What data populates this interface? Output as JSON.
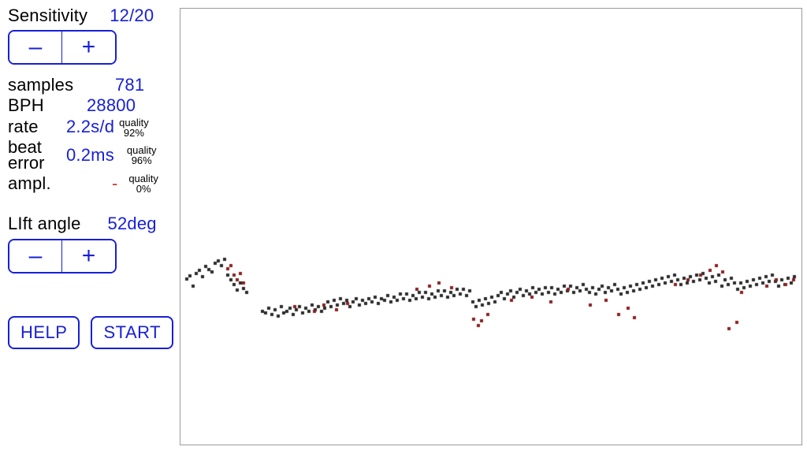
{
  "sensitivity": {
    "label": "Sensitivity",
    "value": "12/20"
  },
  "stepper_minus": "–",
  "stepper_plus": "+",
  "samples": {
    "label": "samples",
    "value": "781"
  },
  "bph": {
    "label": "BPH",
    "value": "28800"
  },
  "rate": {
    "label": "rate",
    "value": "2.2s/d",
    "quality_label": "quality",
    "quality_value": "92%"
  },
  "beat": {
    "label_line1": "beat",
    "label_line2": "error",
    "value": "0.2ms",
    "quality_label": "quality",
    "quality_value": "96%"
  },
  "ampl": {
    "label": "ampl.",
    "value": "-",
    "quality_label": "quality",
    "quality_value": "0%"
  },
  "lift": {
    "label": "LIft angle",
    "value": "52deg"
  },
  "buttons": {
    "help": "HELP",
    "start": "START"
  },
  "colors": {
    "accent": "#1720d6",
    "dot_black": "#2b2b2b",
    "dot_red": "#8a2020"
  },
  "chart_data": {
    "type": "scatter",
    "title": "",
    "xlabel": "",
    "ylabel": "",
    "xlim": [
      0,
      788
    ],
    "ylim": [
      0,
      553
    ],
    "series": [
      {
        "name": "black",
        "points": [
          [
            8,
            343
          ],
          [
            12,
            339
          ],
          [
            16,
            352
          ],
          [
            20,
            336
          ],
          [
            24,
            332
          ],
          [
            28,
            340
          ],
          [
            32,
            327
          ],
          [
            36,
            331
          ],
          [
            40,
            334
          ],
          [
            44,
            323
          ],
          [
            48,
            320
          ],
          [
            52,
            326
          ],
          [
            56,
            318
          ],
          [
            60,
            338
          ],
          [
            64,
            344
          ],
          [
            68,
            350
          ],
          [
            72,
            357
          ],
          [
            76,
            348
          ],
          [
            80,
            355
          ],
          [
            84,
            360
          ],
          [
            104,
            384
          ],
          [
            108,
            386
          ],
          [
            112,
            380
          ],
          [
            116,
            388
          ],
          [
            120,
            382
          ],
          [
            124,
            390
          ],
          [
            128,
            378
          ],
          [
            131,
            386
          ],
          [
            135,
            384
          ],
          [
            139,
            380
          ],
          [
            143,
            388
          ],
          [
            147,
            382
          ],
          [
            151,
            378
          ],
          [
            155,
            386
          ],
          [
            159,
            380
          ],
          [
            163,
            384
          ],
          [
            167,
            376
          ],
          [
            171,
            382
          ],
          [
            175,
            378
          ],
          [
            179,
            384
          ],
          [
            183,
            380
          ],
          [
            187,
            372
          ],
          [
            191,
            378
          ],
          [
            195,
            370
          ],
          [
            199,
            376
          ],
          [
            203,
            368
          ],
          [
            207,
            374
          ],
          [
            211,
            370
          ],
          [
            215,
            378
          ],
          [
            219,
            372
          ],
          [
            223,
            368
          ],
          [
            227,
            376
          ],
          [
            231,
            370
          ],
          [
            235,
            374
          ],
          [
            239,
            368
          ],
          [
            243,
            372
          ],
          [
            247,
            366
          ],
          [
            251,
            374
          ],
          [
            255,
            368
          ],
          [
            259,
            370
          ],
          [
            263,
            364
          ],
          [
            267,
            372
          ],
          [
            271,
            366
          ],
          [
            275,
            370
          ],
          [
            279,
            362
          ],
          [
            283,
            368
          ],
          [
            287,
            362
          ],
          [
            291,
            370
          ],
          [
            295,
            364
          ],
          [
            299,
            368
          ],
          [
            303,
            360
          ],
          [
            307,
            366
          ],
          [
            311,
            360
          ],
          [
            315,
            368
          ],
          [
            319,
            362
          ],
          [
            323,
            366
          ],
          [
            327,
            358
          ],
          [
            331,
            364
          ],
          [
            335,
            358
          ],
          [
            339,
            366
          ],
          [
            343,
            360
          ],
          [
            347,
            364
          ],
          [
            351,
            356
          ],
          [
            355,
            362
          ],
          [
            359,
            356
          ],
          [
            363,
            364
          ],
          [
            367,
            358
          ],
          [
            371,
            372
          ],
          [
            375,
            378
          ],
          [
            379,
            370
          ],
          [
            383,
            376
          ],
          [
            387,
            368
          ],
          [
            391,
            374
          ],
          [
            395,
            366
          ],
          [
            399,
            372
          ],
          [
            403,
            364
          ],
          [
            407,
            360
          ],
          [
            411,
            368
          ],
          [
            415,
            362
          ],
          [
            419,
            358
          ],
          [
            423,
            366
          ],
          [
            427,
            360
          ],
          [
            431,
            356
          ],
          [
            435,
            364
          ],
          [
            439,
            358
          ],
          [
            443,
            362
          ],
          [
            447,
            354
          ],
          [
            451,
            360
          ],
          [
            455,
            356
          ],
          [
            459,
            362
          ],
          [
            463,
            354
          ],
          [
            467,
            360
          ],
          [
            471,
            354
          ],
          [
            475,
            362
          ],
          [
            479,
            356
          ],
          [
            483,
            360
          ],
          [
            487,
            352
          ],
          [
            491,
            358
          ],
          [
            495,
            352
          ],
          [
            499,
            360
          ],
          [
            503,
            354
          ],
          [
            507,
            358
          ],
          [
            511,
            350
          ],
          [
            515,
            356
          ],
          [
            519,
            360
          ],
          [
            523,
            354
          ],
          [
            527,
            362
          ],
          [
            531,
            356
          ],
          [
            535,
            352
          ],
          [
            539,
            360
          ],
          [
            543,
            354
          ],
          [
            547,
            358
          ],
          [
            551,
            350
          ],
          [
            555,
            356
          ],
          [
            559,
            362
          ],
          [
            563,
            354
          ],
          [
            567,
            360
          ],
          [
            571,
            352
          ],
          [
            575,
            358
          ],
          [
            579,
            350
          ],
          [
            583,
            356
          ],
          [
            587,
            348
          ],
          [
            591,
            354
          ],
          [
            595,
            346
          ],
          [
            599,
            352
          ],
          [
            603,
            344
          ],
          [
            607,
            350
          ],
          [
            611,
            342
          ],
          [
            615,
            348
          ],
          [
            619,
            340
          ],
          [
            623,
            346
          ],
          [
            627,
            338
          ],
          [
            631,
            344
          ],
          [
            635,
            350
          ],
          [
            639,
            342
          ],
          [
            643,
            348
          ],
          [
            647,
            340
          ],
          [
            651,
            346
          ],
          [
            655,
            338
          ],
          [
            659,
            344
          ],
          [
            663,
            336
          ],
          [
            667,
            342
          ],
          [
            671,
            348
          ],
          [
            675,
            340
          ],
          [
            679,
            346
          ],
          [
            683,
            338
          ],
          [
            687,
            352
          ],
          [
            691,
            344
          ],
          [
            695,
            350
          ],
          [
            699,
            342
          ],
          [
            703,
            348
          ],
          [
            707,
            356
          ],
          [
            711,
            348
          ],
          [
            715,
            354
          ],
          [
            719,
            346
          ],
          [
            723,
            352
          ],
          [
            727,
            344
          ],
          [
            731,
            350
          ],
          [
            735,
            342
          ],
          [
            739,
            348
          ],
          [
            743,
            340
          ],
          [
            747,
            346
          ],
          [
            751,
            338
          ],
          [
            755,
            346
          ],
          [
            759,
            352
          ],
          [
            763,
            344
          ],
          [
            767,
            350
          ],
          [
            771,
            342
          ],
          [
            775,
            348
          ],
          [
            779,
            340
          ]
        ]
      },
      {
        "name": "red",
        "points": [
          [
            60,
            330
          ],
          [
            64,
            326
          ],
          [
            68,
            338
          ],
          [
            72,
            344
          ],
          [
            76,
            336
          ],
          [
            80,
            348
          ],
          [
            145,
            378
          ],
          [
            170,
            384
          ],
          [
            182,
            376
          ],
          [
            198,
            382
          ],
          [
            212,
            374
          ],
          [
            300,
            356
          ],
          [
            316,
            352
          ],
          [
            328,
            348
          ],
          [
            344,
            354
          ],
          [
            372,
            394
          ],
          [
            378,
            402
          ],
          [
            382,
            396
          ],
          [
            390,
            388
          ],
          [
            420,
            370
          ],
          [
            446,
            366
          ],
          [
            470,
            372
          ],
          [
            492,
            356
          ],
          [
            520,
            376
          ],
          [
            540,
            370
          ],
          [
            556,
            388
          ],
          [
            568,
            380
          ],
          [
            576,
            392
          ],
          [
            628,
            350
          ],
          [
            644,
            344
          ],
          [
            660,
            338
          ],
          [
            672,
            332
          ],
          [
            680,
            326
          ],
          [
            688,
            334
          ],
          [
            696,
            406
          ],
          [
            706,
            398
          ],
          [
            712,
            360
          ],
          [
            744,
            352
          ],
          [
            756,
            344
          ],
          [
            768,
            350
          ],
          [
            778,
            344
          ]
        ]
      }
    ]
  }
}
